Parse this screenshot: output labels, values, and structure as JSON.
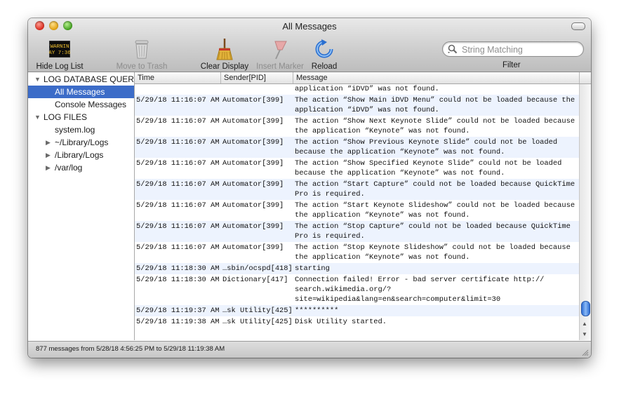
{
  "window": {
    "title": "All Messages"
  },
  "toolbar": {
    "hide_log_list": "Hide Log List",
    "move_to_trash": "Move to Trash",
    "clear_display": "Clear Display",
    "insert_marker": "Insert Marker",
    "reload": "Reload",
    "filter_label": "Filter",
    "search_placeholder": "String Matching",
    "log_icon_line1": "WARNIN",
    "log_icon_line2": "AY 7:36"
  },
  "sidebar": {
    "db_queries": "LOG DATABASE QUERIES",
    "all_messages": "All Messages",
    "console_messages": "Console Messages",
    "log_files": "LOG FILES",
    "system_log": "system.log",
    "user_library_logs": "~/Library/Logs",
    "library_logs": "/Library/Logs",
    "var_log": "/var/log"
  },
  "table": {
    "headers": {
      "time": "Time",
      "sender": "Sender[PID]",
      "message": "Message"
    },
    "rows": [
      {
        "time": "",
        "sender": "",
        "message": "application “iDVD” was not found."
      },
      {
        "time": "5/29/18 11:16:07 AM",
        "sender": "Automator[399]",
        "message": "The action “Show Main iDVD Menu” could not be loaded because the\napplication “iDVD” was not found."
      },
      {
        "time": "5/29/18 11:16:07 AM",
        "sender": "Automator[399]",
        "message": "The action “Show Next Keynote Slide” could not be loaded because\nthe application “Keynote” was not found."
      },
      {
        "time": "5/29/18 11:16:07 AM",
        "sender": "Automator[399]",
        "message": "The action “Show Previous Keynote Slide” could not be loaded\nbecause the application “Keynote” was not found."
      },
      {
        "time": "5/29/18 11:16:07 AM",
        "sender": "Automator[399]",
        "message": "The action “Show Specified Keynote Slide” could not be loaded\nbecause the application “Keynote” was not found."
      },
      {
        "time": "5/29/18 11:16:07 AM",
        "sender": "Automator[399]",
        "message": "The action “Start Capture” could not be loaded because QuickTime\nPro is required."
      },
      {
        "time": "5/29/18 11:16:07 AM",
        "sender": "Automator[399]",
        "message": "The action “Start Keynote Slideshow” could not be loaded because\nthe application “Keynote” was not found."
      },
      {
        "time": "5/29/18 11:16:07 AM",
        "sender": "Automator[399]",
        "message": "The action “Stop Capture” could not be loaded because QuickTime\nPro is required."
      },
      {
        "time": "5/29/18 11:16:07 AM",
        "sender": "Automator[399]",
        "message": "The action “Stop Keynote Slideshow” could not be loaded because\nthe application “Keynote” was not found."
      },
      {
        "time": "5/29/18 11:18:30 AM",
        "sender": "…sbin/ocspd[418]",
        "message": "starting"
      },
      {
        "time": "5/29/18 11:18:30 AM",
        "sender": "Dictionary[417]",
        "message": "Connection failed! Error - bad server certificate http://\nsearch.wikimedia.org/?\nsite=wikipedia&lang=en&search=computer&limit=30"
      },
      {
        "time": "5/29/18 11:19:37 AM",
        "sender": "…sk Utility[425]",
        "message": "**********"
      },
      {
        "time": "5/29/18 11:19:38 AM",
        "sender": "…sk Utility[425]",
        "message": "Disk Utility started."
      }
    ]
  },
  "status": {
    "text": "877 messages from 5/28/18 4:56:25 PM to 5/29/18 11:19:38 AM"
  }
}
